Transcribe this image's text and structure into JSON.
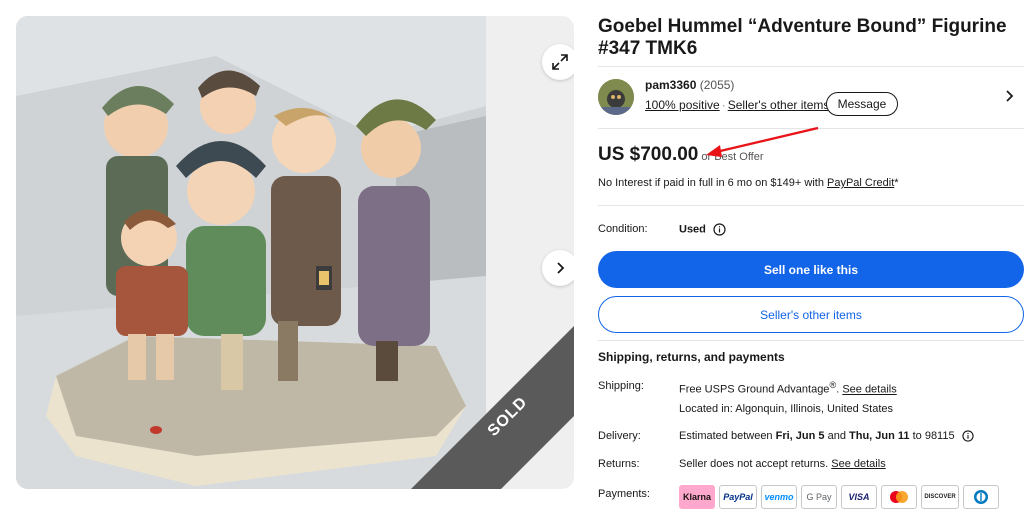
{
  "listing": {
    "title": "Goebel Hummel “Adventure Bound” Figurine #347 TMK6",
    "sold_label": "SOLD"
  },
  "seller": {
    "name": "pam3360",
    "count": "(2055)",
    "positive": "100% positive",
    "other_items_link": "Seller's other items",
    "message_label": "Message"
  },
  "price": {
    "amount": "US $700.00",
    "suffix": "or Best Offer",
    "financing_text": "No Interest if paid in full in 6 mo on $149+ with",
    "financing_link": "PayPal Credit",
    "financing_tail": "*"
  },
  "condition": {
    "label": "Condition:",
    "value": "Used"
  },
  "actions": {
    "sell_label": "Sell one like this",
    "other_items_label": "Seller's other items"
  },
  "shipping": {
    "section_title": "Shipping, returns, and payments",
    "shipping_label": "Shipping:",
    "shipping_value": "Free USPS Ground Advantage",
    "shipping_reg": "®",
    "shipping_link": "See details",
    "location": "Located in: Algonquin, Illinois, United States",
    "delivery_label": "Delivery:",
    "delivery_prefix": "Estimated between",
    "delivery_start": "Fri, Jun 5",
    "delivery_and": "and",
    "delivery_end": "Thu, Jun 11",
    "delivery_suffix": "to 98115",
    "returns_label": "Returns:",
    "returns_value": "Seller does not accept returns.",
    "returns_link": "See details",
    "payments_label": "Payments:"
  },
  "payment_methods": [
    {
      "name": "Klarna",
      "color": "#ffa8cd"
    },
    {
      "name": "PayPal",
      "color": "#003087"
    },
    {
      "name": "venmo",
      "color": "#008cff"
    },
    {
      "name": "G Pay",
      "color": "#5f6368"
    },
    {
      "name": "VISA",
      "color": "#1a1f71"
    },
    {
      "name": "Mastercard",
      "color": "#eb001b"
    },
    {
      "name": "DISCOVER",
      "color": "#e55c20"
    },
    {
      "name": "Diners",
      "color": "#0079be"
    }
  ],
  "colors": {
    "accent": "#1264e8",
    "annotation_arrow": "#e8141a"
  }
}
